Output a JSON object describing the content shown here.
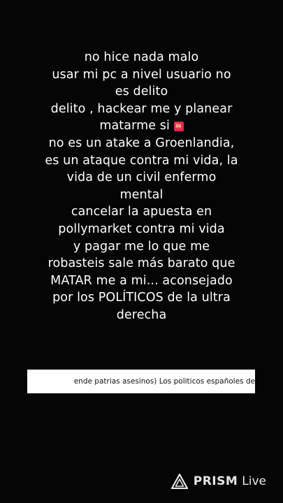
{
  "caption": {
    "lines": [
      "no hice nada malo",
      "usar mi pc a nivel usuario no",
      "es delito",
      "delito , hackear me y planear",
      "matarme si",
      "no es un atake a Groenlandia,",
      "es un ataque contra mi vida, la",
      "vida de un civil enfermo",
      "mental",
      "cancelar la apuesta en",
      "pollymarket contra mi vida",
      "y pagar me lo que me",
      "robasteis sale más barato que",
      "MATAR me a mi... aconsejado",
      "por los POLÍTICOS de la ultra",
      "derecha"
    ],
    "sos_emoji": "🆘",
    "sos_emoji_color": "#e0245e"
  },
  "ticker": {
    "text": "ende patrias asesinos)  Los politicos españoles de"
  },
  "watermark": {
    "brand": "PRISM",
    "suffix": "Live",
    "icon": "prism-logo-icon"
  }
}
